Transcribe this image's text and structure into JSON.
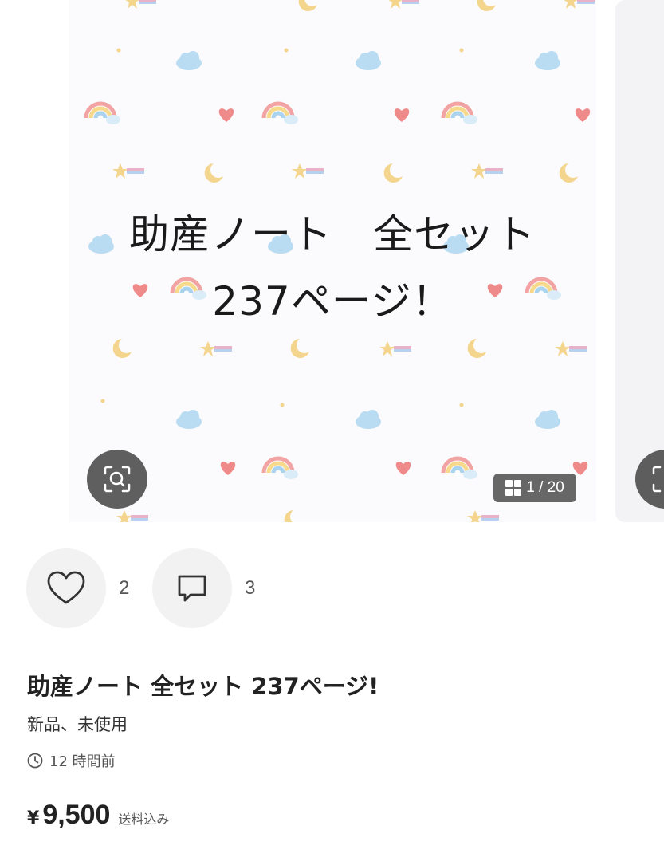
{
  "gallery": {
    "slide_line1": "助産ノート　全セット",
    "slide_line2": "237ページ！",
    "counter": "1 / 20",
    "current_index": 1,
    "total": 20
  },
  "actions": {
    "like_count": "2",
    "comment_count": "3"
  },
  "item": {
    "title": "助産ノート 全セット 237ページ!",
    "condition": "新品、未使用",
    "posted": "12 時間前",
    "currency": "¥",
    "price": "9,500",
    "shipping": "送料込み"
  },
  "colors": {
    "overlay": "#3c3c3c",
    "action_bg": "#f2f2f2",
    "rainbow_red": "#f2a3a3",
    "rainbow_yellow": "#f6d98a",
    "rainbow_blue": "#a9d3ef",
    "heart": "#ef8a8a",
    "moon": "#f4d58e",
    "cloud": "#b9dcf2"
  }
}
